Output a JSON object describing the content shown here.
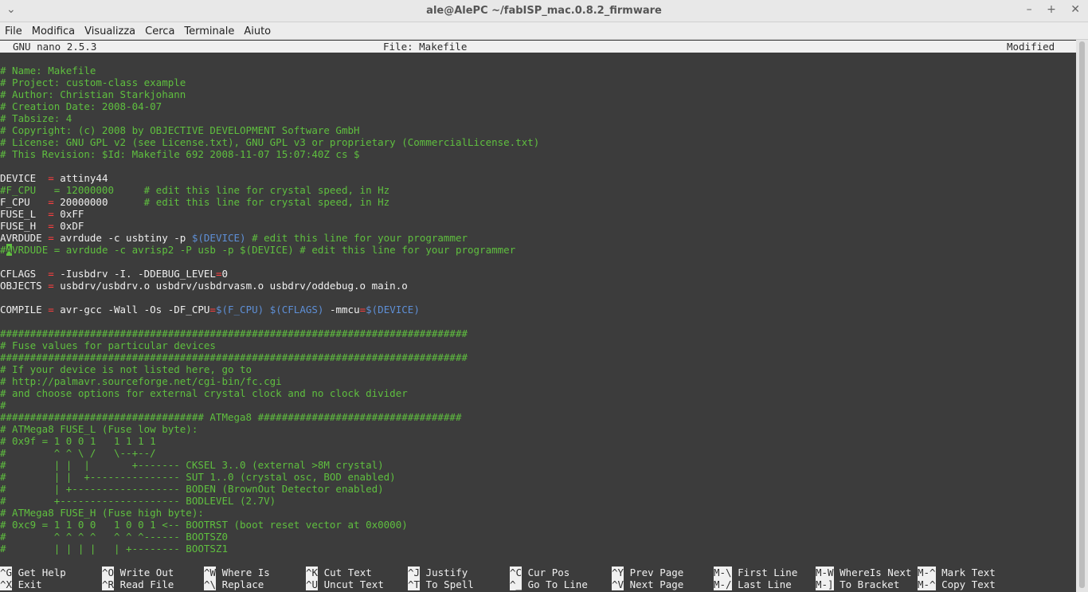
{
  "window": {
    "title": "ale@AlePC ~/fabISP_mac.0.8.2_firmware",
    "controls": [
      "minimize-icon",
      "maximize-icon",
      "close-icon"
    ]
  },
  "menu": [
    "File",
    "Modifica",
    "Visualizza",
    "Cerca",
    "Terminale",
    "Aiuto"
  ],
  "nano": {
    "version": "GNU nano 2.5.3",
    "file": "File: Makefile",
    "status": "Modified"
  },
  "lines": [
    [
      [
        "cmt",
        "# Name: Makefile"
      ]
    ],
    [
      [
        "cmt",
        "# Project: custom-class example"
      ]
    ],
    [
      [
        "cmt",
        "# Author: Christian Starkjohann"
      ]
    ],
    [
      [
        "cmt",
        "# Creation Date: 2008-04-07"
      ]
    ],
    [
      [
        "cmt",
        "# Tabsize: 4"
      ]
    ],
    [
      [
        "cmt",
        "# Copyright: (c) 2008 by OBJECTIVE DEVELOPMENT Software GmbH"
      ]
    ],
    [
      [
        "cmt",
        "# License: GNU GPL v2 (see License.txt), GNU GPL v3 or proprietary (CommercialLicense.txt)"
      ]
    ],
    [
      [
        "cmt",
        "# This Revision: $Id: Makefile 692 2008-11-07 15:07:40Z cs $"
      ]
    ],
    [],
    [
      [
        "txt",
        "DEVICE  "
      ],
      [
        "eq",
        "="
      ],
      [
        "txt",
        " attiny44"
      ]
    ],
    [
      [
        "cmt",
        "#F_CPU   = 12000000     # edit this line for crystal speed, in Hz"
      ]
    ],
    [
      [
        "txt",
        "F_CPU   "
      ],
      [
        "eq",
        "="
      ],
      [
        "txt",
        " 20000000      "
      ],
      [
        "cmt",
        "# edit this line for crystal speed, in Hz"
      ]
    ],
    [
      [
        "txt",
        "FUSE_L  "
      ],
      [
        "eq",
        "="
      ],
      [
        "txt",
        " 0xFF"
      ]
    ],
    [
      [
        "txt",
        "FUSE_H  "
      ],
      [
        "eq",
        "="
      ],
      [
        "txt",
        " 0xDF"
      ]
    ],
    [
      [
        "txt",
        "AVRDUDE "
      ],
      [
        "eq",
        "="
      ],
      [
        "txt",
        " avrdude -c usbtiny -p "
      ],
      [
        "var",
        "$(DEVICE)"
      ],
      [
        "txt",
        " "
      ],
      [
        "cmt",
        "# edit this line for your programmer"
      ]
    ],
    [
      [
        "cmt",
        "#"
      ],
      [
        "cursor",
        "A"
      ],
      [
        "cmt",
        "VRDUDE = avrdude -c avrisp2 -P usb -p $(DEVICE) # edit this line for your programmer"
      ]
    ],
    [],
    [
      [
        "txt",
        "CFLAGS  "
      ],
      [
        "eq",
        "="
      ],
      [
        "txt",
        " -Iusbdrv -I. -DDEBUG_LEVEL"
      ],
      [
        "eq",
        "="
      ],
      [
        "txt",
        "0"
      ]
    ],
    [
      [
        "txt",
        "OBJECTS "
      ],
      [
        "eq",
        "="
      ],
      [
        "txt",
        " usbdrv/usbdrv.o usbdrv/usbdrvasm.o usbdrv/oddebug.o main.o"
      ]
    ],
    [],
    [
      [
        "txt",
        "COMPILE "
      ],
      [
        "eq",
        "="
      ],
      [
        "txt",
        " avr-gcc -Wall -Os -DF_CPU"
      ],
      [
        "eq",
        "="
      ],
      [
        "var",
        "$(F_CPU)"
      ],
      [
        "txt",
        " "
      ],
      [
        "var",
        "$(CFLAGS)"
      ],
      [
        "txt",
        " -mmcu"
      ],
      [
        "eq",
        "="
      ],
      [
        "var",
        "$(DEVICE)"
      ]
    ],
    [],
    [
      [
        "cmt",
        "##############################################################################"
      ]
    ],
    [
      [
        "cmt",
        "# Fuse values for particular devices"
      ]
    ],
    [
      [
        "cmt",
        "##############################################################################"
      ]
    ],
    [
      [
        "cmt",
        "# If your device is not listed here, go to"
      ]
    ],
    [
      [
        "cmt",
        "# http://palmavr.sourceforge.net/cgi-bin/fc.cgi"
      ]
    ],
    [
      [
        "cmt",
        "# and choose options for external crystal clock and no clock divider"
      ]
    ],
    [
      [
        "cmt",
        "#"
      ]
    ],
    [
      [
        "cmt",
        "################################## ATMega8 ##################################"
      ]
    ],
    [
      [
        "cmt",
        "# ATMega8 FUSE_L (Fuse low byte):"
      ]
    ],
    [
      [
        "cmt",
        "# 0x9f = 1 0 0 1   1 1 1 1"
      ]
    ],
    [
      [
        "cmt",
        "#        ^ ^ \\ /   \\--+--/"
      ]
    ],
    [
      [
        "cmt",
        "#        | |  |       +------- CKSEL 3..0 (external >8M crystal)"
      ]
    ],
    [
      [
        "cmt",
        "#        | |  +--------------- SUT 1..0 (crystal osc, BOD enabled)"
      ]
    ],
    [
      [
        "cmt",
        "#        | +------------------ BODEN (BrownOut Detector enabled)"
      ]
    ],
    [
      [
        "cmt",
        "#        +-------------------- BODLEVEL (2.7V)"
      ]
    ],
    [
      [
        "cmt",
        "# ATMega8 FUSE_H (Fuse high byte):"
      ]
    ],
    [
      [
        "cmt",
        "# 0xc9 = 1 1 0 0   1 0 0 1 <-- BOOTRST (boot reset vector at 0x0000)"
      ]
    ],
    [
      [
        "cmt",
        "#        ^ ^ ^ ^   ^ ^ ^------ BOOTSZ0"
      ]
    ],
    [
      [
        "cmt",
        "#        | | | |   | +-------- BOOTSZ1"
      ]
    ]
  ],
  "shortcuts": [
    [
      {
        "key": "^G",
        "label": "Get Help"
      },
      {
        "key": "^X",
        "label": "Exit"
      }
    ],
    [
      {
        "key": "^O",
        "label": "Write Out"
      },
      {
        "key": "^R",
        "label": "Read File"
      }
    ],
    [
      {
        "key": "^W",
        "label": "Where Is"
      },
      {
        "key": "^\\",
        "label": "Replace"
      }
    ],
    [
      {
        "key": "^K",
        "label": "Cut Text"
      },
      {
        "key": "^U",
        "label": "Uncut Text"
      }
    ],
    [
      {
        "key": "^J",
        "label": "Justify"
      },
      {
        "key": "^T",
        "label": "To Spell"
      }
    ],
    [
      {
        "key": "^C",
        "label": "Cur Pos"
      },
      {
        "key": "^_",
        "label": "Go To Line"
      }
    ],
    [
      {
        "key": "^Y",
        "label": "Prev Page"
      },
      {
        "key": "^V",
        "label": "Next Page"
      }
    ],
    [
      {
        "key": "M-\\",
        "label": "First Line"
      },
      {
        "key": "M-/",
        "label": "Last Line"
      }
    ],
    [
      {
        "key": "M-W",
        "label": "WhereIs Next"
      },
      {
        "key": "M-]",
        "label": "To Bracket"
      }
    ],
    [
      {
        "key": "M-^",
        "label": "Mark Text"
      },
      {
        "key": "M-^",
        "label": "Copy Text"
      }
    ]
  ],
  "colors": {
    "comment": "#5fbf3f",
    "operator": "#ff4040",
    "variable": "#5e8fd6",
    "background": "#3c3c3c",
    "text": "#f0f0f0"
  }
}
